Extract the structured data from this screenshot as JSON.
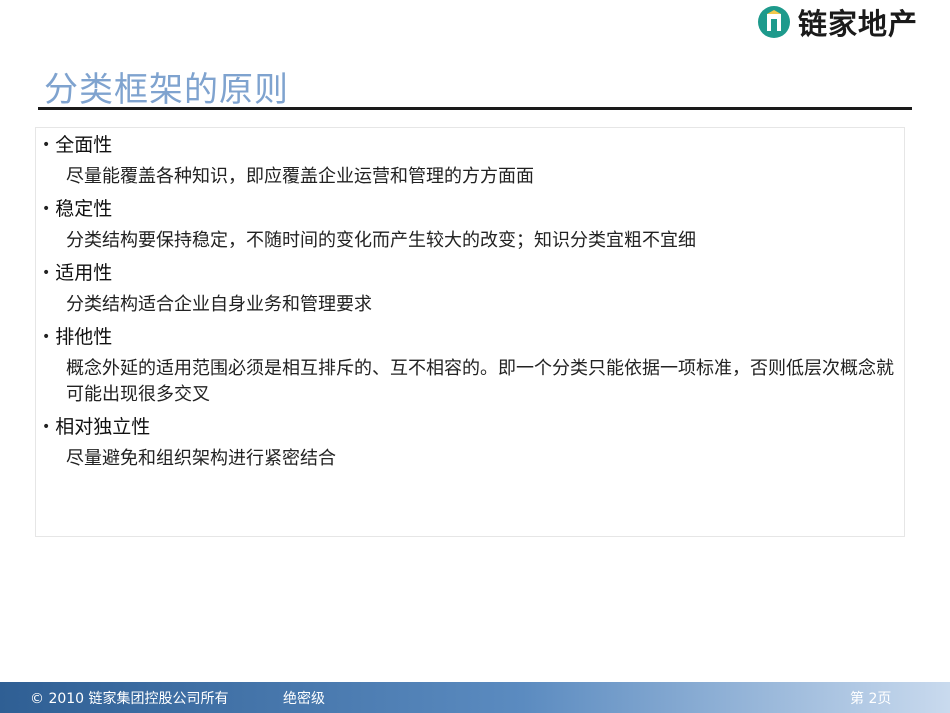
{
  "header": {
    "logo_text": "链家地产",
    "colors": {
      "logo_mark": "#1e9a8c",
      "title": "#7fa3cf",
      "footer_start": "#2f5f94",
      "footer_end": "#c9daee"
    }
  },
  "slide": {
    "title": "分类框架的原则",
    "items": [
      {
        "heading": "全面性",
        "description": "尽量能覆盖各种知识，即应覆盖企业运营和管理的方方面面"
      },
      {
        "heading": "稳定性",
        "description": "分类结构要保持稳定，不随时间的变化而产生较大的改变；知识分类宜粗不宜细"
      },
      {
        "heading": "适用性",
        "description": "分类结构适合企业自身业务和管理要求"
      },
      {
        "heading": "排他性",
        "description": "概念外延的适用范围必须是相互排斥的、互不相容的。即一个分类只能依据一项标准，否则低层次概念就可能出现很多交叉"
      },
      {
        "heading": "相对独立性",
        "description": "尽量避免和组织架构进行紧密结合"
      }
    ]
  },
  "footer": {
    "copyright": "© 2010  链家集团控股公司所有",
    "confidential": "绝密级",
    "page_label": "第 2页"
  }
}
